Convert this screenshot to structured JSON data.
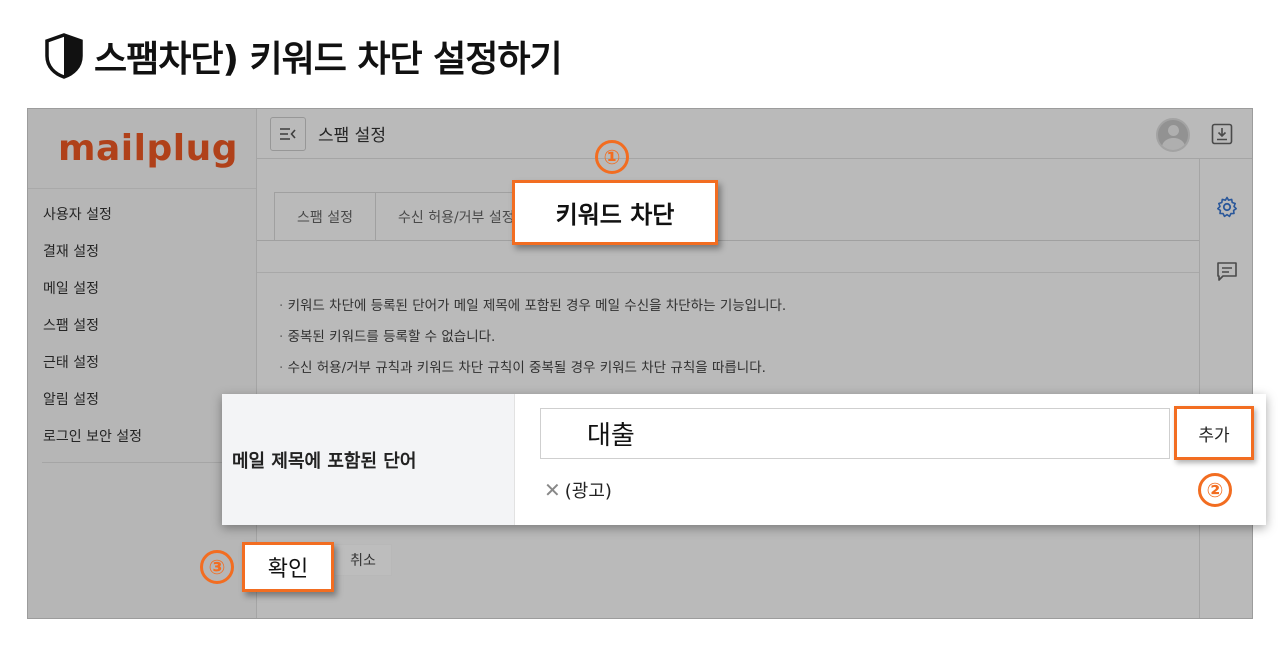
{
  "page_title": "스팸차단) 키워드 차단 설정하기",
  "app": {
    "logo": "mailplug",
    "topbar_title": "스팸 설정",
    "sidebar": {
      "items": [
        {
          "label": "사용자 설정"
        },
        {
          "label": "결재 설정"
        },
        {
          "label": "메일 설정"
        },
        {
          "label": "스팸 설정"
        },
        {
          "label": "근태 설정"
        },
        {
          "label": "알림 설정"
        },
        {
          "label": "로그인 보안 설정"
        }
      ]
    },
    "tabs": [
      {
        "label": "스팸 설정"
      },
      {
        "label": "수신 허용/거부 설정"
      },
      {
        "label": "키워드 차단"
      }
    ],
    "description": [
      "키워드 차단에 등록된 단어가 메일 제목에 포함된 경우 메일 수신을 차단하는 기능입니다.",
      "중복된 키워드를 등록할 수 없습니다.",
      "수신 허용/거부 규칙과 키워드 차단 규칙이 중복될 경우 키워드 차단 규칙을 따릅니다."
    ]
  },
  "keyword_panel": {
    "label": "메일 제목에 포함된 단어",
    "input_value": "대출",
    "add_label": "추가",
    "tags": [
      {
        "text": "(광고)"
      }
    ]
  },
  "buttons": {
    "confirm": "확인",
    "cancel": "취소"
  },
  "steps": [
    "①",
    "②",
    "③"
  ],
  "colors": {
    "accent": "#f26d21",
    "logo": "#f15a24"
  }
}
